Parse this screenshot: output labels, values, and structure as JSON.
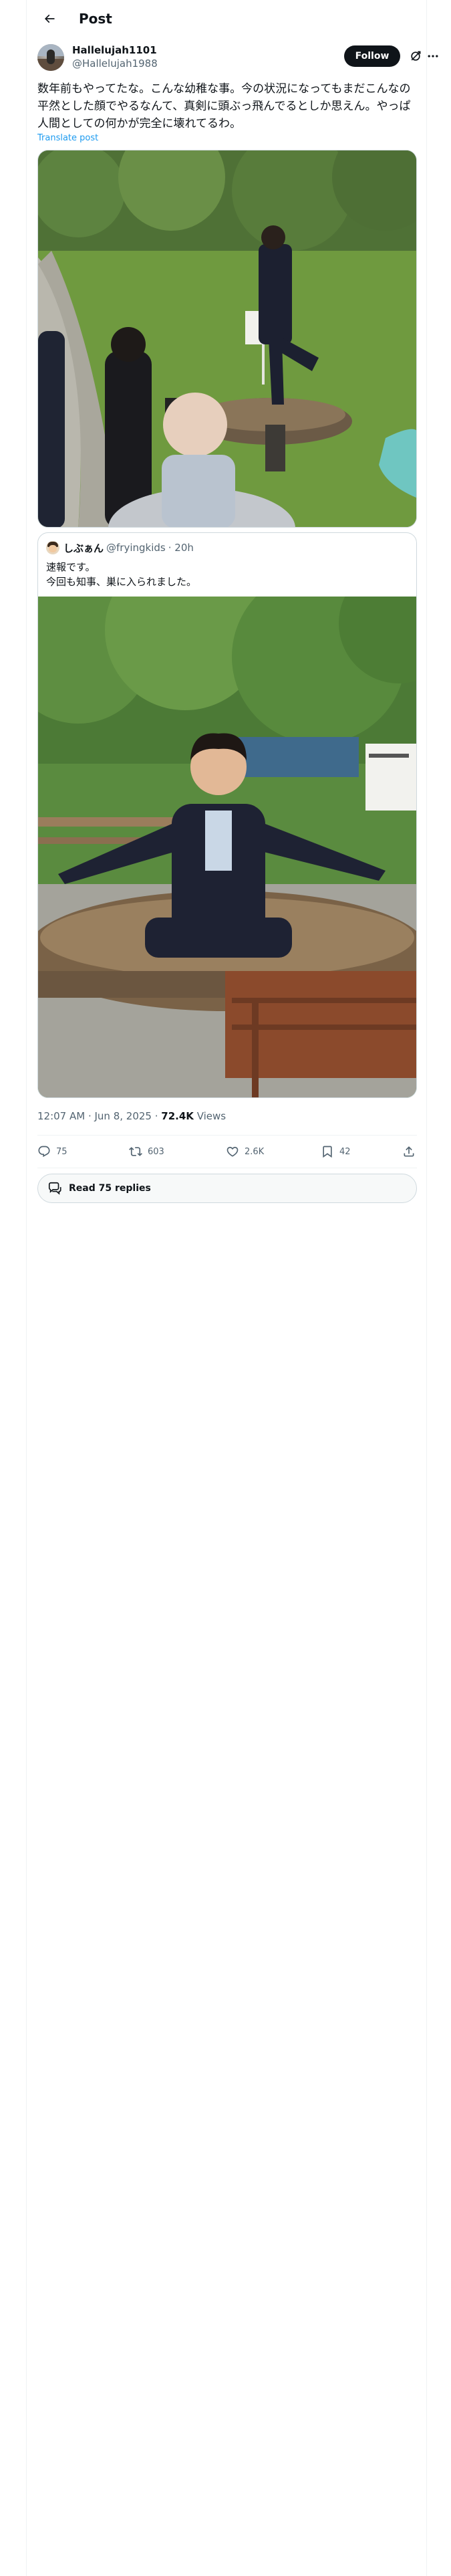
{
  "header": {
    "back_icon": "arrow-left-icon",
    "title": "Post"
  },
  "post": {
    "author_name": "Hallelujah1101",
    "author_handle": "@Hallelujah1988",
    "follow_label": "Follow",
    "grok_icon": "grok-icon",
    "more_icon": "more-horizontal-icon",
    "text": "数年前もやってたな。こんな幼稚な事。今の状況になってもまだこんなの平然とした顔でやるなんて、真剣に頭ぶっ飛んでるとしか思えん。やっぱ人間としての何かが完全に壊れてるわ。",
    "translate_label": "Translate post",
    "media_description_icon": "photo-icon"
  },
  "quote": {
    "author_name": "しぶぁん",
    "author_handle": "@fryingkids",
    "time": "· 20h",
    "lines": [
      "速報です。",
      "今回も知事、巣に入られました。"
    ]
  },
  "meta": {
    "timestamp": "12:07 AM · Jun 8, 2025 · ",
    "views_count": "72.4K",
    "views_label": " Views"
  },
  "actions": {
    "replies": "75",
    "reposts": "603",
    "likes": "2.6K",
    "bookmarks": "42"
  },
  "read_replies_label": "Read 75 replies",
  "colors": {
    "accent": "#1d9bf0",
    "text": "#0f1419",
    "muted": "#536471",
    "border": "#cfd9de"
  }
}
